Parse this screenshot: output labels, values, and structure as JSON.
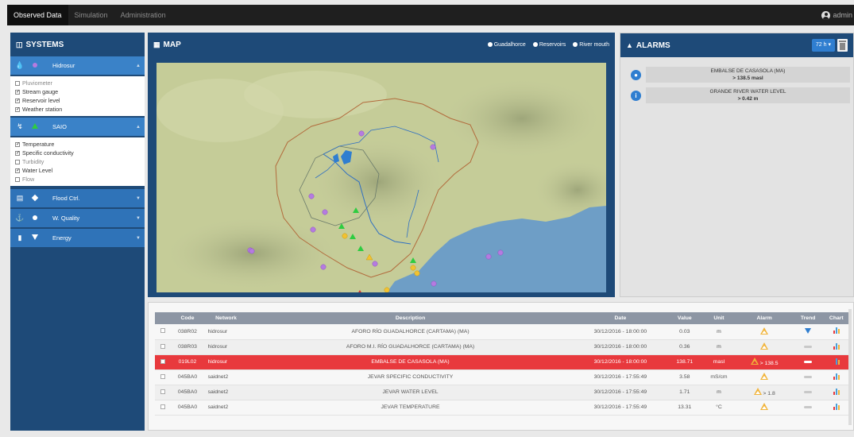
{
  "nav": {
    "tabs": [
      {
        "label": "Observed Data",
        "active": true
      },
      {
        "label": "Simulation",
        "active": false
      },
      {
        "label": "Administration",
        "active": false
      }
    ],
    "user": "admin"
  },
  "systems": {
    "title": "SYSTEMS",
    "groups": [
      {
        "name": "Hidrosur",
        "icon": "water-drop-icon",
        "marker": "purple-dot",
        "expanded": true,
        "options": [
          {
            "label": "Pluviometer",
            "checked": false
          },
          {
            "label": "Stream gauge",
            "checked": true
          },
          {
            "label": "Reservoir level",
            "checked": true
          },
          {
            "label": "Weather station",
            "checked": true
          }
        ]
      },
      {
        "name": "SAIO",
        "icon": "sensor-icon",
        "marker": "green-triangle",
        "expanded": true,
        "options": [
          {
            "label": "Temperature",
            "checked": true
          },
          {
            "label": "Specific conductivity",
            "checked": true
          },
          {
            "label": "Turbidity",
            "checked": false
          },
          {
            "label": "Water Level",
            "checked": true
          },
          {
            "label": "Flow",
            "checked": false
          }
        ]
      },
      {
        "name": "Flood Ctrl.",
        "icon": "flood-icon",
        "marker": "diamond",
        "expanded": false
      },
      {
        "name": "W. Quality",
        "icon": "quality-icon",
        "marker": "white-dot",
        "expanded": false
      },
      {
        "name": "Energy",
        "icon": "energy-icon",
        "marker": "down-triangle",
        "expanded": false
      }
    ]
  },
  "map": {
    "title": "MAP",
    "legend": [
      "Guadalhorce",
      "Reservoirs",
      "River mouth"
    ]
  },
  "alarms": {
    "title": "ALARMS",
    "range": "72 h",
    "items": [
      {
        "icon": "water-drop-icon",
        "name": "EMBALSE DE CASASOLA (MA)",
        "value": "> 138.5 masl"
      },
      {
        "icon": "info-icon",
        "name": "GRANDE RIVER WATER LEVEL",
        "value": "> 0.42 m"
      }
    ]
  },
  "table": {
    "headers": [
      "",
      "Code",
      "Network",
      "Description",
      "Date",
      "Value",
      "Unit",
      "Alarm",
      "Trend",
      "Chart"
    ],
    "rows": [
      {
        "code": "038R02",
        "network": "hidrosur",
        "description": "AFORO RÍO GUADALHORCE (CARTAMA) (MA)",
        "date": "30/12/2016 - 18:00:00",
        "value": "0.03",
        "unit": "m",
        "alarm": "",
        "trend": "down"
      },
      {
        "code": "038R03",
        "network": "hidrosur",
        "description": "AFORO M.I. RÍO GUADALHORCE (CARTAMA) (MA)",
        "date": "30/12/2016 - 18:00:00",
        "value": "0.36",
        "unit": "m",
        "alarm": "",
        "trend": "flat"
      },
      {
        "code": "019L02",
        "network": "hidrosur",
        "description": "EMBALSE DE CASASOLA (MA)",
        "date": "30/12/2016 - 18:00:00",
        "value": "138.71",
        "unit": "masl",
        "alarm": "> 138.5",
        "trend": "flat",
        "alert": true
      },
      {
        "code": "045BA0",
        "network": "saidnet2",
        "description": "JEVAR SPECIFIC CONDUCTIVITY",
        "date": "30/12/2016 - 17:55:49",
        "value": "3.58",
        "unit": "mS/cm",
        "alarm": "",
        "trend": "flat"
      },
      {
        "code": "045BA0",
        "network": "saidnet2",
        "description": "JEVAR WATER LEVEL",
        "date": "30/12/2016 - 17:55:49",
        "value": "1.71",
        "unit": "m",
        "alarm": "> 1.8",
        "trend": "flat"
      },
      {
        "code": "045BA0",
        "network": "saidnet2",
        "description": "JEVAR TEMPERATURE",
        "date": "30/12/2016 - 17:55:49",
        "value": "13.31",
        "unit": "°C",
        "alarm": "",
        "trend": "flat"
      }
    ]
  },
  "colors": {
    "panel_header": "#1e4a78",
    "system_row": "#2f73b8",
    "alert_row": "#e8393d",
    "alarm_bell": "#f1b43a",
    "sea": "#6e9ec6"
  }
}
